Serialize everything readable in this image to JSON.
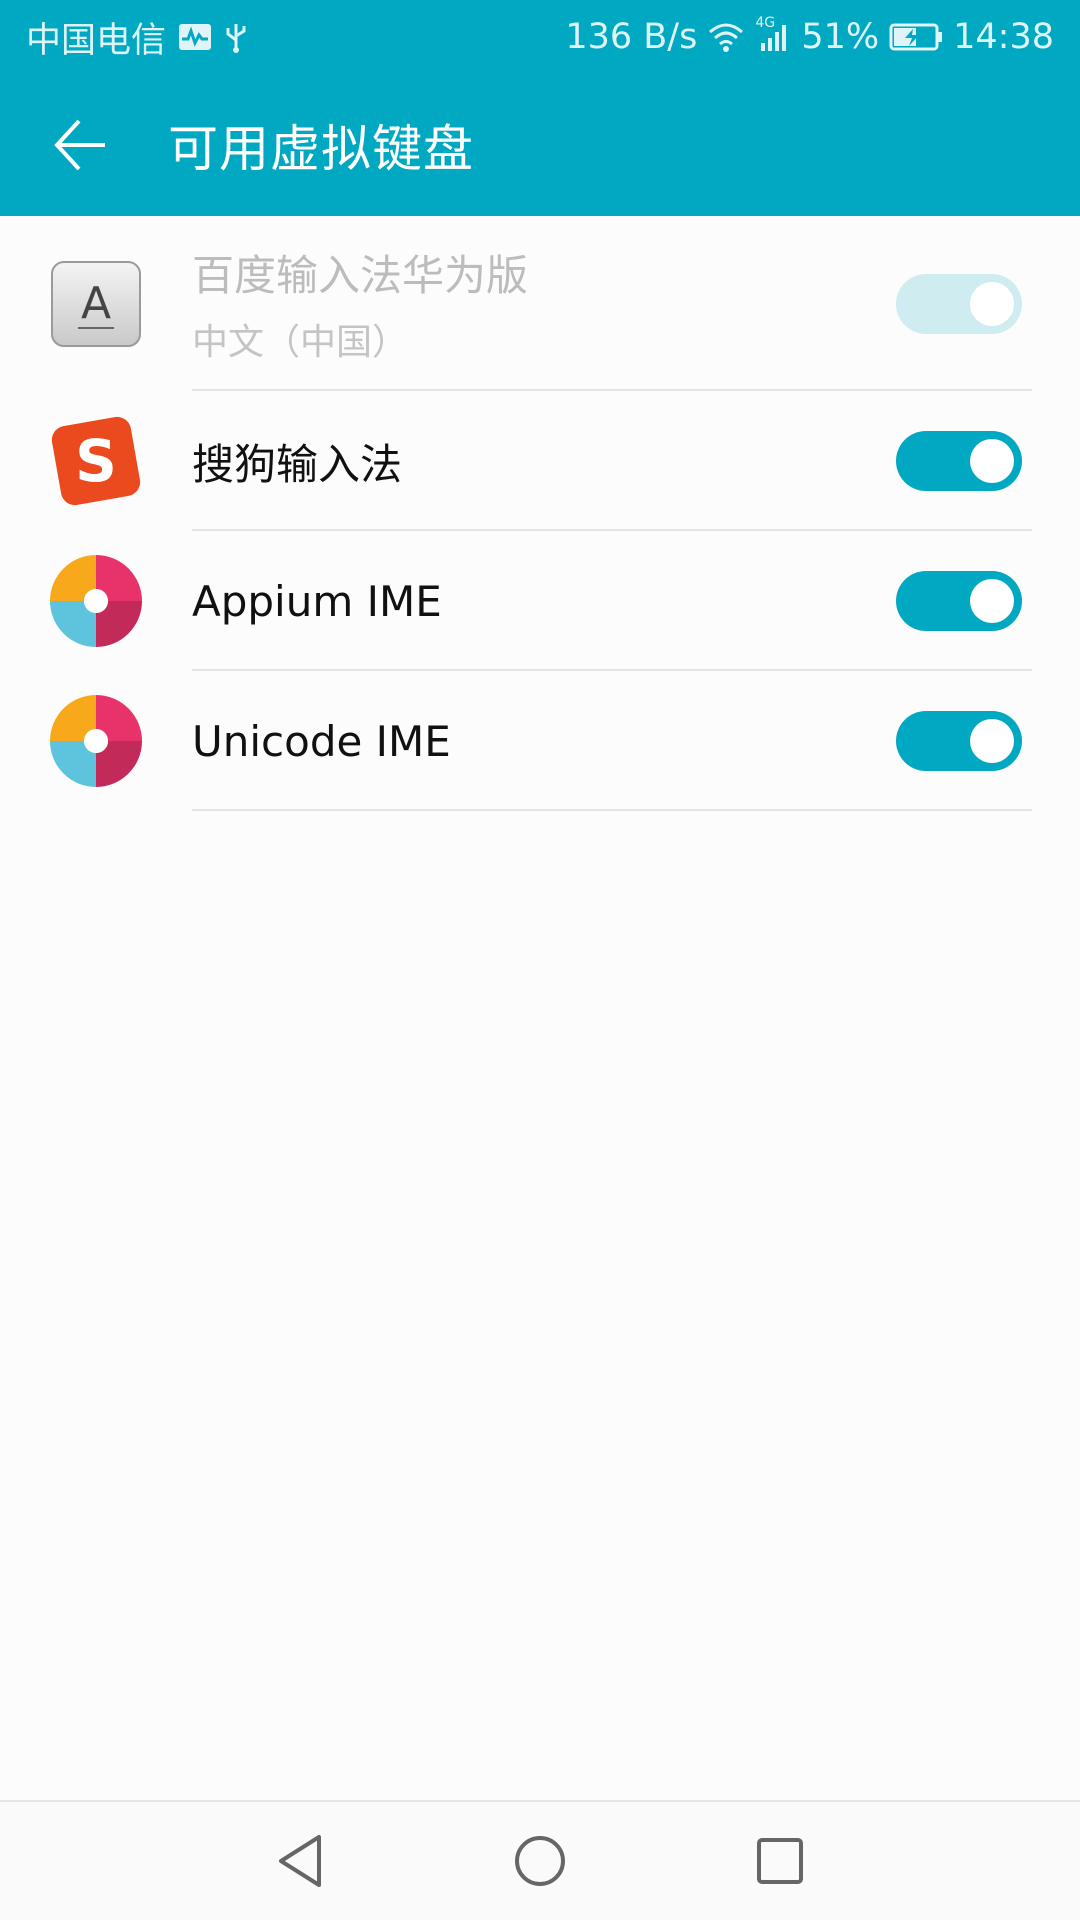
{
  "status_bar": {
    "carrier": "中国电信",
    "net_speed": "136 B/s",
    "network_type": "4G",
    "battery": "51%",
    "time": "14:38"
  },
  "app_bar": {
    "title": "可用虚拟键盘",
    "back_icon": "arrow-left-icon"
  },
  "keyboards": [
    {
      "name": "百度输入法华为版",
      "subtitle": "中文（中国）",
      "enabled": true,
      "disabled": true,
      "icon": "baidu-ime-icon"
    },
    {
      "name": "搜狗输入法",
      "enabled": true,
      "disabled": false,
      "icon": "sogou-icon"
    },
    {
      "name": "Appium IME",
      "enabled": true,
      "disabled": false,
      "icon": "appium-icon"
    },
    {
      "name": "Unicode IME",
      "enabled": true,
      "disabled": false,
      "icon": "appium-icon"
    }
  ],
  "nav_bar": {
    "icons": [
      "back-triangle-icon",
      "home-circle-icon",
      "recents-square-icon"
    ]
  },
  "colors": {
    "accent": "#00a8c2",
    "accent_disabled": "#cfecf1",
    "background": "#fcfcfc"
  }
}
